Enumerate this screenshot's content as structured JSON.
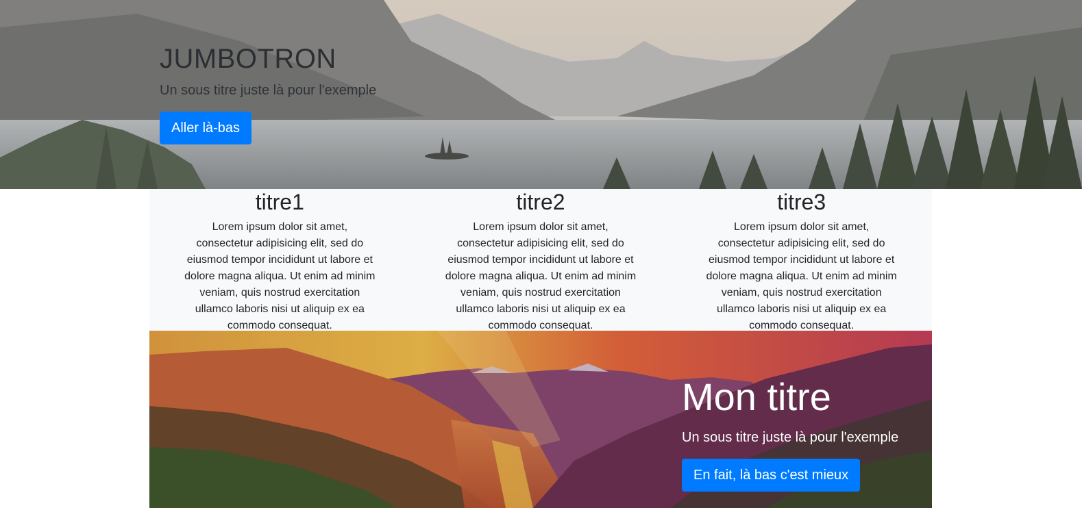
{
  "jumbotron": {
    "title": "JUMBOTRON",
    "subtitle": "Un sous titre juste là pour l'exemple",
    "button_label": "Aller là-bas"
  },
  "columns": [
    {
      "title": "titre1",
      "text": "Lorem ipsum dolor sit amet, consectetur adipisicing elit, sed do eiusmod tempor incididunt ut labore et dolore magna aliqua. Ut enim ad minim veniam, quis nostrud exercitation ullamco laboris nisi ut aliquip ex ea commodo consequat."
    },
    {
      "title": "titre2",
      "text": "Lorem ipsum dolor sit amet, consectetur adipisicing elit, sed do eiusmod tempor incididunt ut labore et dolore magna aliqua. Ut enim ad minim veniam, quis nostrud exercitation ullamco laboris nisi ut aliquip ex ea commodo consequat."
    },
    {
      "title": "titre3",
      "text": "Lorem ipsum dolor sit amet, consectetur adipisicing elit, sed do eiusmod tempor incididunt ut labore et dolore magna aliqua. Ut enim ad minim veniam, quis nostrud exercitation ullamco laboris nisi ut aliquip ex ea commodo consequat."
    }
  ],
  "feature": {
    "title": "Mon titre",
    "subtitle": "Un sous titre juste là pour l'exemple",
    "button_label": "En fait, là bas c'est mieux"
  },
  "colors": {
    "primary": "#007bff",
    "panel_bg": "#f8f9fa",
    "text": "#212529"
  }
}
